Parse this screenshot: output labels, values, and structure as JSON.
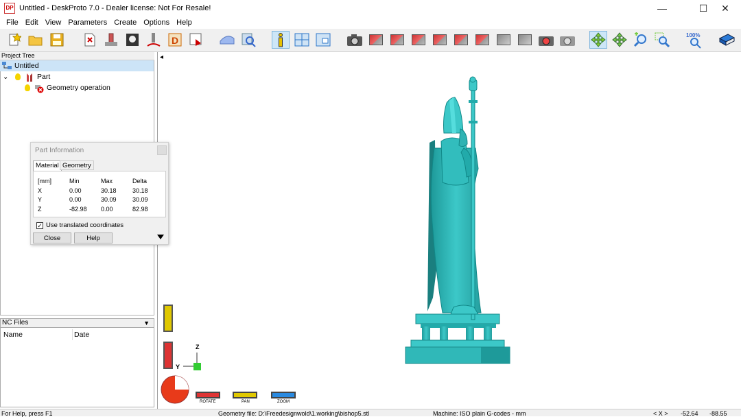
{
  "window": {
    "title": "Untitled - DeskProto 7.0 - Dealer license: Not For Resale!",
    "app_icon_text": "DP",
    "minimize_glyph": "—",
    "maximize_glyph": "☐",
    "close_glyph": "✕"
  },
  "menu": [
    "File",
    "Edit",
    "View",
    "Parameters",
    "Create",
    "Options",
    "Help"
  ],
  "toolbar": {
    "zoom_percent_label": "100%"
  },
  "project_tree": {
    "header": "Project Tree",
    "root": "Untitled",
    "part": "Part",
    "geometry_operation": "Geometry operation",
    "expand_glyph": "⌄"
  },
  "nc_files": {
    "header": "NC Files",
    "dropdown_glyph": "▼",
    "columns": [
      "Name",
      "Date"
    ]
  },
  "part_information": {
    "title": "Part Information",
    "tabs": [
      "Material",
      "Geometry"
    ],
    "columns": [
      "[mm]",
      "Min",
      "Max",
      "Delta"
    ],
    "rows": [
      [
        "X",
        "0.00",
        "30.18",
        "30.18"
      ],
      [
        "Y",
        "0.00",
        "30.09",
        "30.09"
      ],
      [
        "Z",
        "-82.98",
        "0.00",
        "82.98"
      ]
    ],
    "use_translated_label": "Use translated coordinates",
    "use_translated_checked": true,
    "check_glyph": "✓",
    "close_label": "Close",
    "help_label": "Help"
  },
  "viewport": {
    "collapse_glyph": "◂",
    "axis_z": "Z",
    "axis_y": "Y",
    "mode_labels": [
      "ROTATE",
      "PAN",
      "ZOOM"
    ],
    "model_color": "#3cc8c8",
    "model_shadow_color": "#1e9a9a"
  },
  "statusbar": {
    "help": "For Help, press F1",
    "geometry_file": "Geometry file: D:\\Freedesignwold\\1.working\\bishop5.stl",
    "machine": "Machine: ISO plain G-codes - mm",
    "coord_label": "< X >",
    "x_value": "-52.64",
    "y_value": "-88.55"
  }
}
